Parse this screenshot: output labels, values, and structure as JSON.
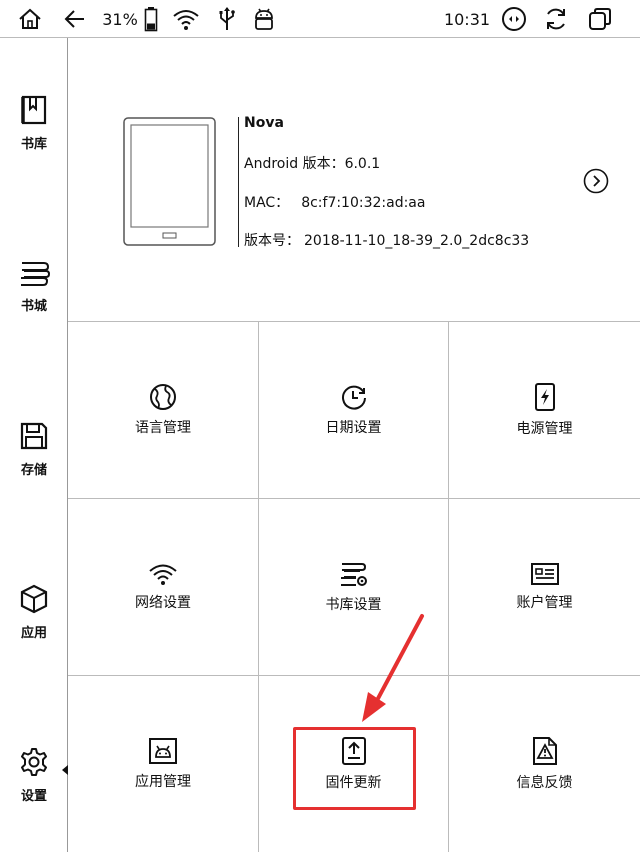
{
  "status_bar": {
    "battery_percent": "31%",
    "time": "10:31"
  },
  "sidebar": {
    "items": [
      {
        "label": "书库",
        "icon": "bookmark-book-icon"
      },
      {
        "label": "书城",
        "icon": "book-stack-icon"
      },
      {
        "label": "存储",
        "icon": "floppy-disk-icon"
      },
      {
        "label": "应用",
        "icon": "cube-icon"
      },
      {
        "label": "设置",
        "icon": "gear-icon"
      }
    ]
  },
  "device": {
    "model": "Nova",
    "android_label": "Android 版本：",
    "android_version": "6.0.1",
    "mac_label": "MAC：",
    "mac_address": "8c:f7:10:32:ad:aa",
    "build_label": "版本号：",
    "build_number": "2018-11-10_18-39_2.0_2dc8c33"
  },
  "settings": {
    "tiles": [
      {
        "label": "语言管理",
        "icon": "globe-icon"
      },
      {
        "label": "日期设置",
        "icon": "clock-icon"
      },
      {
        "label": "电源管理",
        "icon": "battery-lightning-icon"
      },
      {
        "label": "网络设置",
        "icon": "wifi-icon"
      },
      {
        "label": "书库设置",
        "icon": "books-gear-icon"
      },
      {
        "label": "账户管理",
        "icon": "id-card-icon"
      },
      {
        "label": "应用管理",
        "icon": "android-icon"
      },
      {
        "label": "固件更新",
        "icon": "firmware-upload-icon"
      },
      {
        "label": "信息反馈",
        "icon": "warning-feedback-icon"
      }
    ]
  },
  "annotation": {
    "highlight_color": "#e53030"
  }
}
